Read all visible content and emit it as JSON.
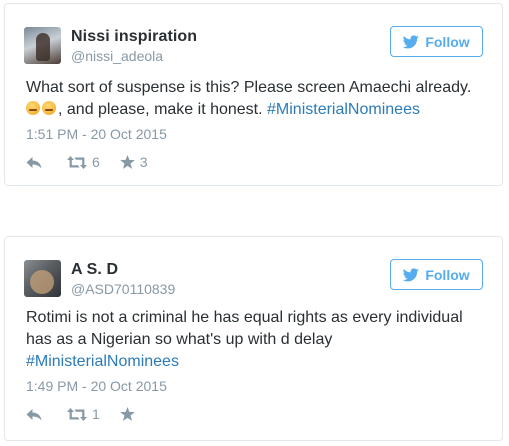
{
  "tweets": [
    {
      "name": "Nissi inspiration",
      "handle": "@nissi_adeola",
      "follow_label": "Follow",
      "text_line1": "What sort of suspense is this? Please screen Amaechi already.",
      "text_line2_pre": ", and please, make it honest. ",
      "hashtag": "#MinisterialNominees",
      "timestamp": "1:51 PM - 20 Oct 2015",
      "retweets": "6",
      "likes": "3"
    },
    {
      "name": "A S. D",
      "handle": "@ASD70110839",
      "follow_label": "Follow",
      "text_line1": "Rotimi is not a criminal he has equal rights as every individual",
      "text_line2": "has as a Nigerian so what's up with d delay",
      "hashtag": "#MinisterialNominees",
      "timestamp": "1:49 PM - 20 Oct 2015",
      "retweets": "1",
      "likes": ""
    }
  ],
  "colors": {
    "accent": "#55acee",
    "hashtag": "#2b7bb9",
    "text": "#292f33",
    "muted": "#8899a6",
    "border": "#e1e8ed"
  },
  "icons": [
    "bird-icon",
    "reply-icon",
    "retweet-icon",
    "star-icon",
    "angry-face-emoji"
  ]
}
